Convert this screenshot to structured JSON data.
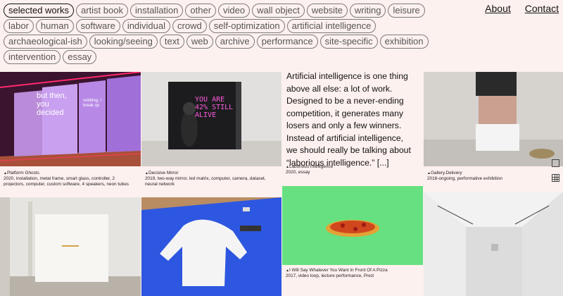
{
  "tags": [
    "selected works",
    "artist book",
    "installation",
    "other",
    "video",
    "wall object",
    "website",
    "writing",
    "leisure",
    "labor",
    "human",
    "software",
    "individual",
    "crowd",
    "self-optimization",
    "artificial intelligence",
    "archaeological-ish",
    "looking/seeing",
    "text",
    "web",
    "archive",
    "performance",
    "site-specific",
    "exhibition",
    "intervention",
    "essay"
  ],
  "nav": {
    "about": "About",
    "contact": "Contact"
  },
  "works": {
    "platform_ghosts": {
      "title": "Platform Ghosts",
      "meta": "2020, installation, metal frame, smart glass, controller, 2 projectors, computer, custom software, 4 speakers, neon tubes",
      "screen_text_1": "but then, you decided",
      "screen_text_2": "sobbing, I break up"
    },
    "decisive_mirror": {
      "title": "Decisive Mirror",
      "meta": "2019, two-way mirror, led matrix, computer, camera, dataset, neural network",
      "screen_text": "YOU ARE 42% STILL ALIVE"
    },
    "laborious_intelligence": {
      "title": "Laborious Intelligence",
      "meta": "2020, essay",
      "essay": "Artificial intelligence is one thing above all else: a lot of work. Designed to be a never-ending competition, it generates many losers and only a few winners. Instead of artificial intelligence, we should really be talking about “laborious intelligence.” [...]"
    },
    "gallery_delivery": {
      "title": "Gallery.Delivery",
      "meta": "2018-ongoing, performative exhibition"
    },
    "pizza": {
      "title": "I Will Say Whatever You Want In Front Of A Pizza",
      "meta": "2017, video loop, lecture performance, Prezi"
    }
  }
}
